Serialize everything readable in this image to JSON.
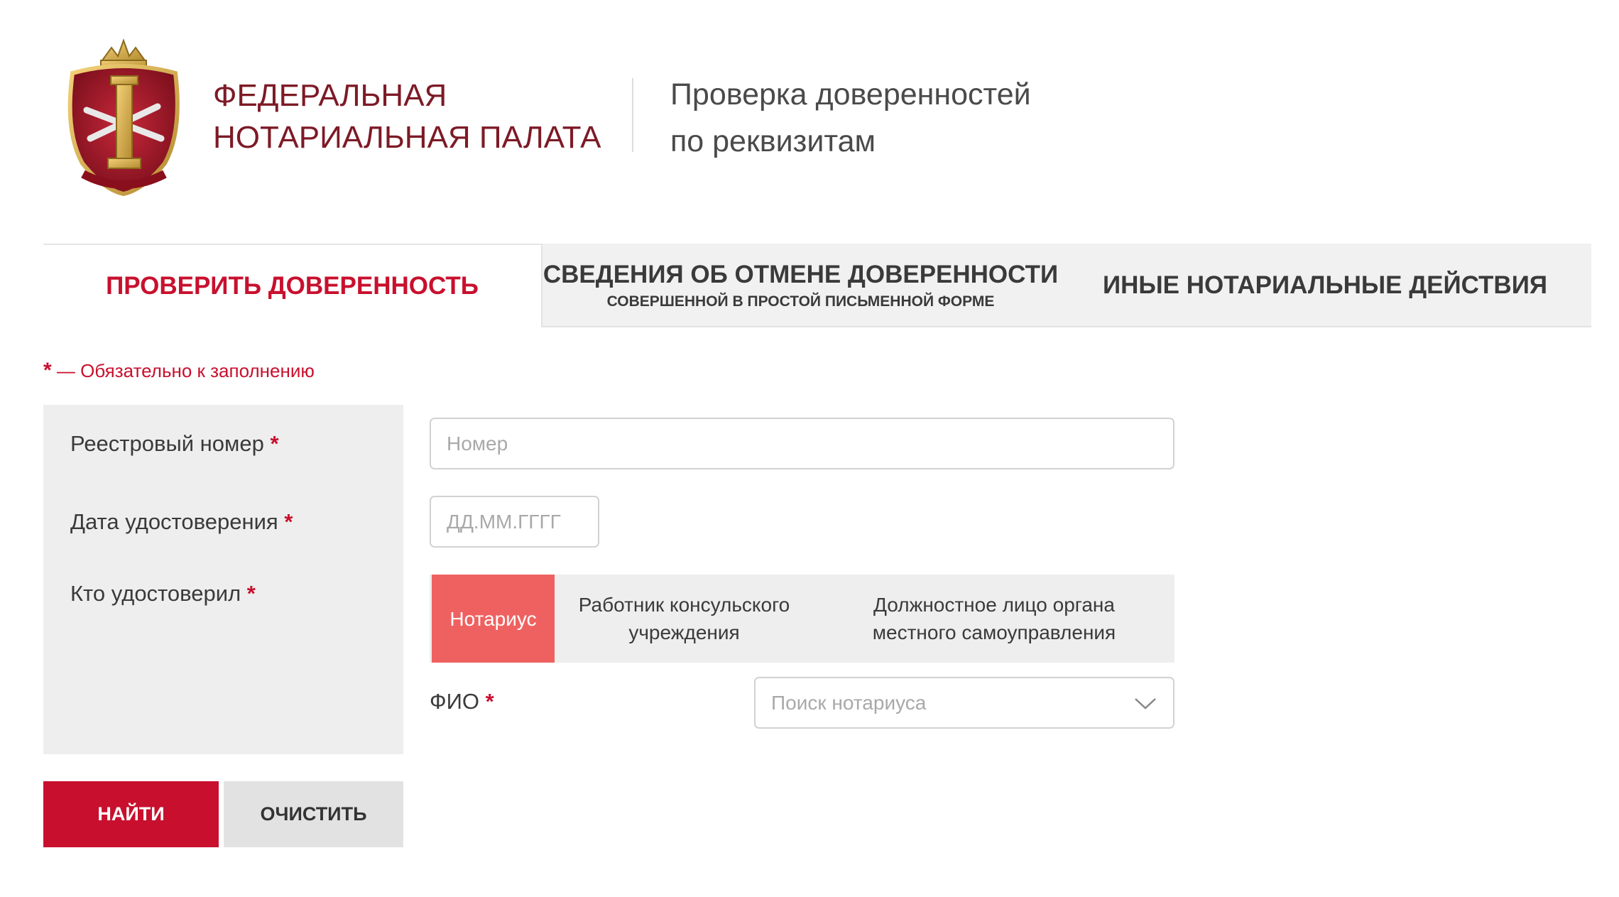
{
  "header": {
    "org_name_line1": "ФЕДЕРАЛЬНАЯ",
    "org_name_line2": "НОТАРИАЛЬНАЯ ПАЛАТА",
    "page_title_line1": "Проверка доверенностей",
    "page_title_line2": "по реквизитам",
    "logo_icon": "notary-chamber-emblem"
  },
  "tabs": [
    {
      "label": "ПРОВЕРИТЬ ДОВЕРЕННОСТЬ",
      "active": true
    },
    {
      "label": "СВЕДЕНИЯ ОБ ОТМЕНЕ ДОВЕРЕННОСТИ",
      "sublabel": "СОВЕРШЕННОЙ В ПРОСТОЙ ПИСЬМЕННОЙ ФОРМЕ",
      "active": false
    },
    {
      "label": "ИНЫЕ НОТАРИАЛЬНЫЕ ДЕЙСТВИЯ",
      "active": false
    }
  ],
  "required_note": {
    "star": "*",
    "text": " — Обязательно к заполнению"
  },
  "form": {
    "required_mark": "*",
    "registry_number": {
      "label": "Реестровый номер",
      "placeholder": "Номер",
      "value": ""
    },
    "date": {
      "label": "Дата удостоверения",
      "placeholder": "ДД.ММ.ГГГГ",
      "value": ""
    },
    "certified_by": {
      "label": "Кто удостоверил",
      "options": [
        {
          "line1": "Нотариус",
          "line2": "",
          "selected": true
        },
        {
          "line1": "Работник консульского",
          "line2": "учреждения",
          "selected": false
        },
        {
          "line1": "Должностное лицо органа",
          "line2": "местного самоуправления",
          "selected": false
        }
      ]
    },
    "fio": {
      "label": "ФИО",
      "placeholder": "Поиск нотариуса",
      "icon": "chevron-down-icon"
    }
  },
  "buttons": {
    "find": "НАЙТИ",
    "clear": "ОЧИСТИТЬ"
  },
  "colors": {
    "accent": "#c8102e",
    "active_option": "#ef6160",
    "org_name": "#7d1a26",
    "panel": "#eeeeee"
  }
}
